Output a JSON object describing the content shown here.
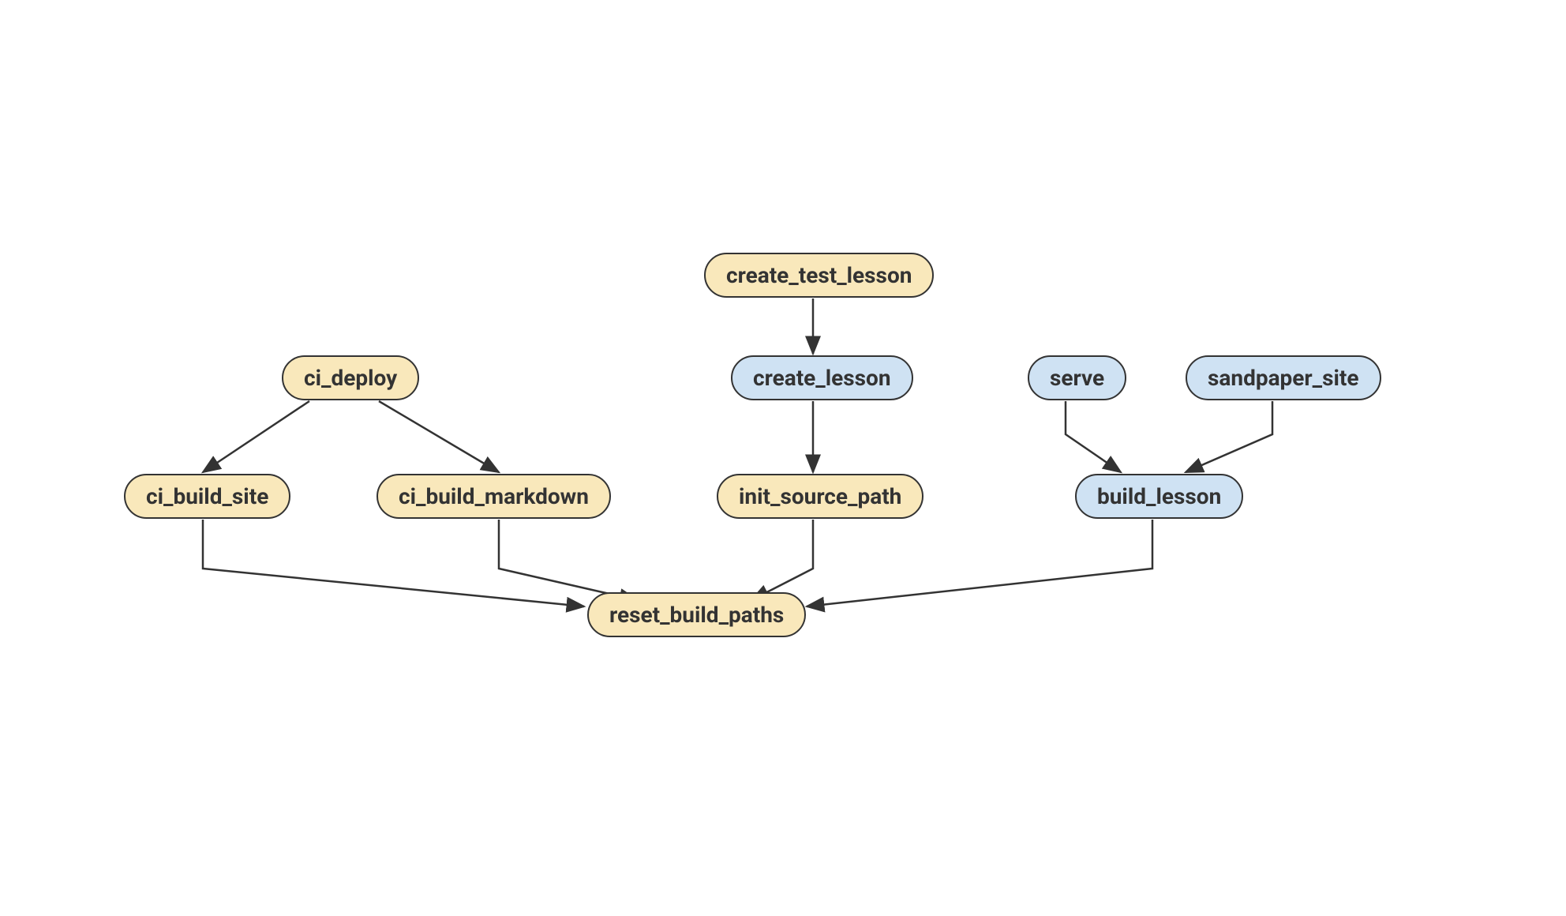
{
  "diagram": {
    "nodes": {
      "create_test_lesson": {
        "label": "create_test_lesson",
        "color": "yellow"
      },
      "ci_deploy": {
        "label": "ci_deploy",
        "color": "yellow"
      },
      "create_lesson": {
        "label": "create_lesson",
        "color": "blue"
      },
      "serve": {
        "label": "serve",
        "color": "blue"
      },
      "sandpaper_site": {
        "label": "sandpaper_site",
        "color": "blue"
      },
      "ci_build_site": {
        "label": "ci_build_site",
        "color": "yellow"
      },
      "ci_build_markdown": {
        "label": "ci_build_markdown",
        "color": "yellow"
      },
      "init_source_path": {
        "label": "init_source_path",
        "color": "yellow"
      },
      "build_lesson": {
        "label": "build_lesson",
        "color": "blue"
      },
      "reset_build_paths": {
        "label": "reset_build_paths",
        "color": "yellow"
      }
    },
    "edges": [
      {
        "from": "create_test_lesson",
        "to": "create_lesson"
      },
      {
        "from": "create_lesson",
        "to": "init_source_path"
      },
      {
        "from": "ci_deploy",
        "to": "ci_build_site"
      },
      {
        "from": "ci_deploy",
        "to": "ci_build_markdown"
      },
      {
        "from": "serve",
        "to": "build_lesson"
      },
      {
        "from": "sandpaper_site",
        "to": "build_lesson"
      },
      {
        "from": "ci_build_site",
        "to": "reset_build_paths"
      },
      {
        "from": "ci_build_markdown",
        "to": "reset_build_paths"
      },
      {
        "from": "init_source_path",
        "to": "reset_build_paths"
      },
      {
        "from": "build_lesson",
        "to": "reset_build_paths"
      }
    ],
    "colors": {
      "yellow": "#f9e8bb",
      "blue": "#cfe2f3",
      "border": "#333333",
      "edge": "#333333"
    }
  }
}
